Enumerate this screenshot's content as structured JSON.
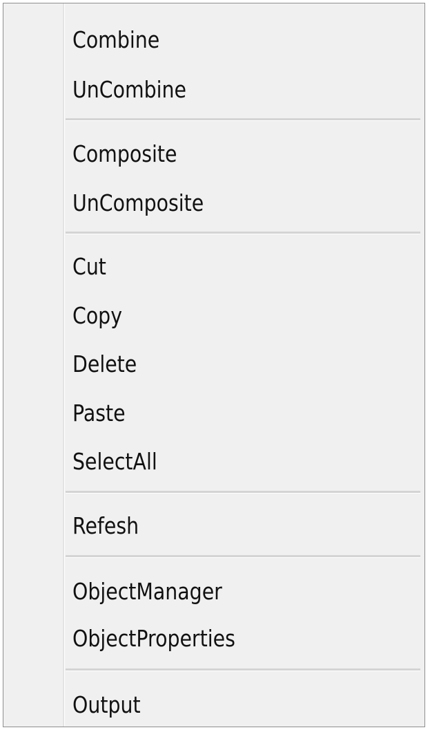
{
  "context_menu": {
    "items": [
      {
        "label": "Combine"
      },
      {
        "label": "UnCombine"
      },
      {
        "label": "Composite"
      },
      {
        "label": "UnComposite"
      },
      {
        "label": "Cut"
      },
      {
        "label": "Copy"
      },
      {
        "label": "Delete"
      },
      {
        "label": "Paste"
      },
      {
        "label": "SelectAll"
      },
      {
        "label": "Refesh"
      },
      {
        "label": "ObjectManager"
      },
      {
        "label": "ObjectProperties"
      },
      {
        "label": "Output"
      }
    ]
  }
}
